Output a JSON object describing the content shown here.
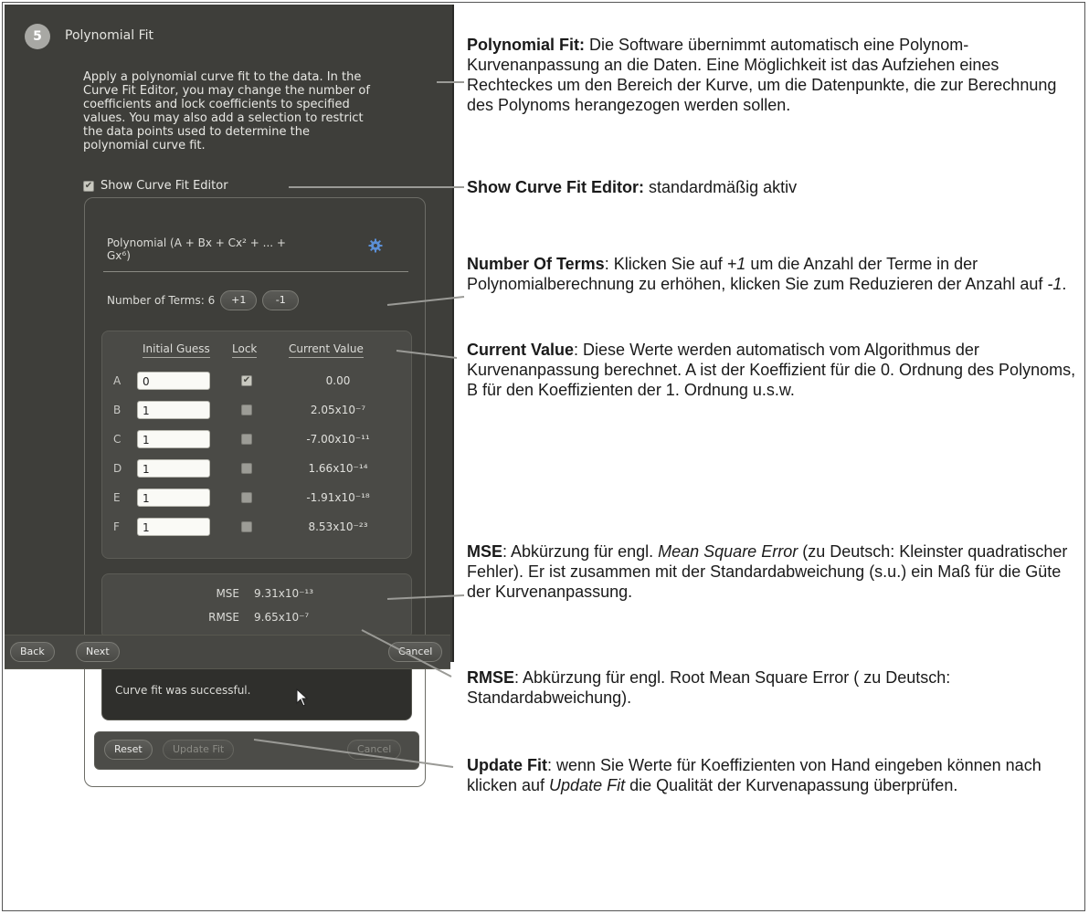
{
  "panel": {
    "step_number": "5",
    "step_title": "Polynomial Fit",
    "description_lines": [
      "Apply a polynomial curve fit to the data.  In the",
      "Curve Fit Editor, you may change the number of",
      "coefficients and lock coefficients to specified",
      "values.  You may also add a selection to restrict",
      "the data points used to determine the",
      "polynomial curve fit."
    ],
    "show_editor_label": "Show Curve Fit Editor",
    "show_editor_checked": true,
    "editor": {
      "poly_title_line1": "Polynomial (A + Bx + Cx² + ... +",
      "poly_title_line2": "Gx⁶)",
      "terms_label": "Number of Terms: 6",
      "plus_label": "+1",
      "minus_label": "-1",
      "headers": {
        "initial": "Initial Guess",
        "lock": "Lock",
        "current": "Current Value"
      },
      "coefficients": [
        {
          "letter": "A",
          "initial": "0",
          "locked": true,
          "value": "0.00"
        },
        {
          "letter": "B",
          "initial": "1",
          "locked": false,
          "value": "2.05x10⁻⁷"
        },
        {
          "letter": "C",
          "initial": "1",
          "locked": false,
          "value": "-7.00x10⁻¹¹"
        },
        {
          "letter": "D",
          "initial": "1",
          "locked": false,
          "value": "1.66x10⁻¹⁴"
        },
        {
          "letter": "E",
          "initial": "1",
          "locked": false,
          "value": "-1.91x10⁻¹⁸"
        },
        {
          "letter": "F",
          "initial": "1",
          "locked": false,
          "value": "8.53x10⁻²³"
        }
      ],
      "mse_label": "MSE",
      "mse_value": "9.31x10⁻¹³",
      "rmse_label": "RMSE",
      "rmse_value": "9.65x10⁻⁷",
      "status_text": "Curve fit was successful.",
      "reset_label": "Reset",
      "update_fit_label": "Update Fit",
      "cancel_label": "Cancel"
    },
    "buttons": {
      "back": "Back",
      "next": "Next",
      "cancel": "Cancel"
    }
  },
  "annotations": [
    {
      "title": "Polynomial Fit:",
      "text": " Die Software übernimmt automatisch eine Polynom-Kurvenanpassung an die Daten. Eine Möglichkeit ist das Aufziehen eines Rechteckes um den Bereich der Kurve, um die Datenpunkte, die zur Berechnung des Polynoms herangezogen werden sollen."
    },
    {
      "title": "Show Curve Fit Editor:",
      "text": " standardmäßig aktiv"
    },
    {
      "title": "Number Of Terms",
      "t1": ": Klicken Sie auf ",
      "i1": "+1",
      "t2": " um die Anzahl der Terme in der Polynomialberechnung zu erhöhen, klicken Sie zum Reduzieren der Anzahl auf ",
      "i2": "-1",
      "t3": "."
    },
    {
      "title": "Current Value",
      "text": ": Diese Werte werden automatisch vom Algorithmus der Kurvenanpassung berechnet. A ist der Koeffizient für die 0. Ordnung des Polynoms, B für den Koeffizienten der 1. Ordnung u.s.w."
    },
    {
      "title": "MSE",
      "t1": ": Abkürzung für engl. ",
      "i1": "Mean Square Error",
      "t2": " (zu Deutsch: Kleinster quadratischer Fehler). Er ist zusammen mit der Standardabweichung (s.u.) ein Maß für die Güte der Kurvenanpassung."
    },
    {
      "title": "RMSE",
      "text": ":  Abkürzung für engl. Root Mean Square Error ( zu Deutsch: Standardabweichung)."
    },
    {
      "title": "Update Fit",
      "t1": ": wenn Sie Werte für Koeffizienten von Hand eingeben können nach klicken auf ",
      "i1": "Update Fit",
      "t2": " die Qualität der Kurvenapassung überprüfen."
    }
  ]
}
